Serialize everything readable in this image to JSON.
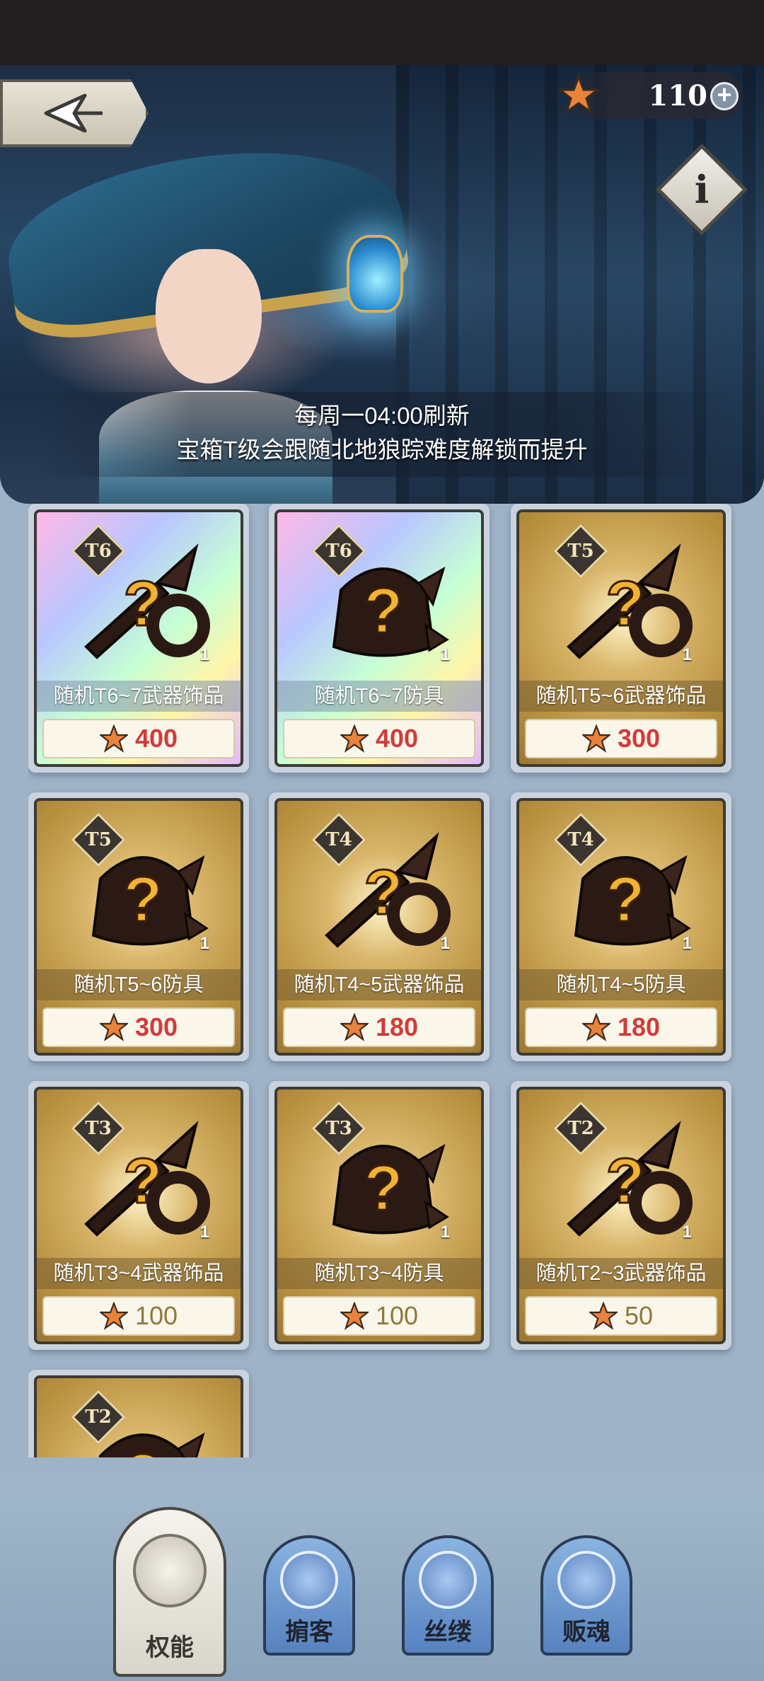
{
  "header": {
    "currency_value": "110",
    "currency_add": "+",
    "info": "i"
  },
  "banner": {
    "line1": "每周一04:00刷新",
    "line2": "宝箱T级会跟随北地狼踪难度解锁而提升"
  },
  "colors": {
    "price_red": "#d23b3b",
    "price_olive": "#8a7a3c",
    "card_gold": "#b8913f",
    "tab_blue": "#5682bf"
  },
  "items": [
    {
      "tier": "T6",
      "name": "随机T6~7武器饰品",
      "price": "400",
      "qty": "1",
      "icon": "weapon-mystery-icon",
      "style": "rainbow"
    },
    {
      "tier": "T6",
      "name": "随机T6~7防具",
      "price": "400",
      "qty": "1",
      "icon": "armor-mystery-icon",
      "style": "rainbow"
    },
    {
      "tier": "T5",
      "name": "随机T5~6武器饰品",
      "price": "300",
      "qty": "1",
      "icon": "weapon-mystery-icon",
      "style": "gold"
    },
    {
      "tier": "T5",
      "name": "随机T5~6防具",
      "price": "300",
      "qty": "1",
      "icon": "armor-mystery-icon",
      "style": "gold"
    },
    {
      "tier": "T4",
      "name": "随机T4~5武器饰品",
      "price": "180",
      "qty": "1",
      "icon": "weapon-mystery-icon",
      "style": "gold"
    },
    {
      "tier": "T4",
      "name": "随机T4~5防具",
      "price": "180",
      "qty": "1",
      "icon": "armor-mystery-icon",
      "style": "gold"
    },
    {
      "tier": "T3",
      "name": "随机T3~4武器饰品",
      "price": "100",
      "qty": "1",
      "icon": "weapon-mystery-icon",
      "style": "gold"
    },
    {
      "tier": "T3",
      "name": "随机T3~4防具",
      "price": "100",
      "qty": "1",
      "icon": "armor-mystery-icon",
      "style": "gold"
    },
    {
      "tier": "T2",
      "name": "随机T2~3武器饰品",
      "price": "50",
      "qty": "1",
      "icon": "weapon-mystery-icon",
      "style": "gold"
    },
    {
      "tier": "T2",
      "name": "",
      "price": "",
      "qty": "",
      "icon": "armor-mystery-icon",
      "style": "gold"
    }
  ],
  "tabs": [
    {
      "label": "权能",
      "icon": "star-emblem-icon",
      "active": true
    },
    {
      "label": "掮客",
      "icon": "broker-emblem-icon",
      "active": false
    },
    {
      "label": "丝缕",
      "icon": "lantern-emblem-icon",
      "active": false
    },
    {
      "label": "贩魂",
      "icon": "soul-emblem-icon",
      "active": false
    }
  ]
}
